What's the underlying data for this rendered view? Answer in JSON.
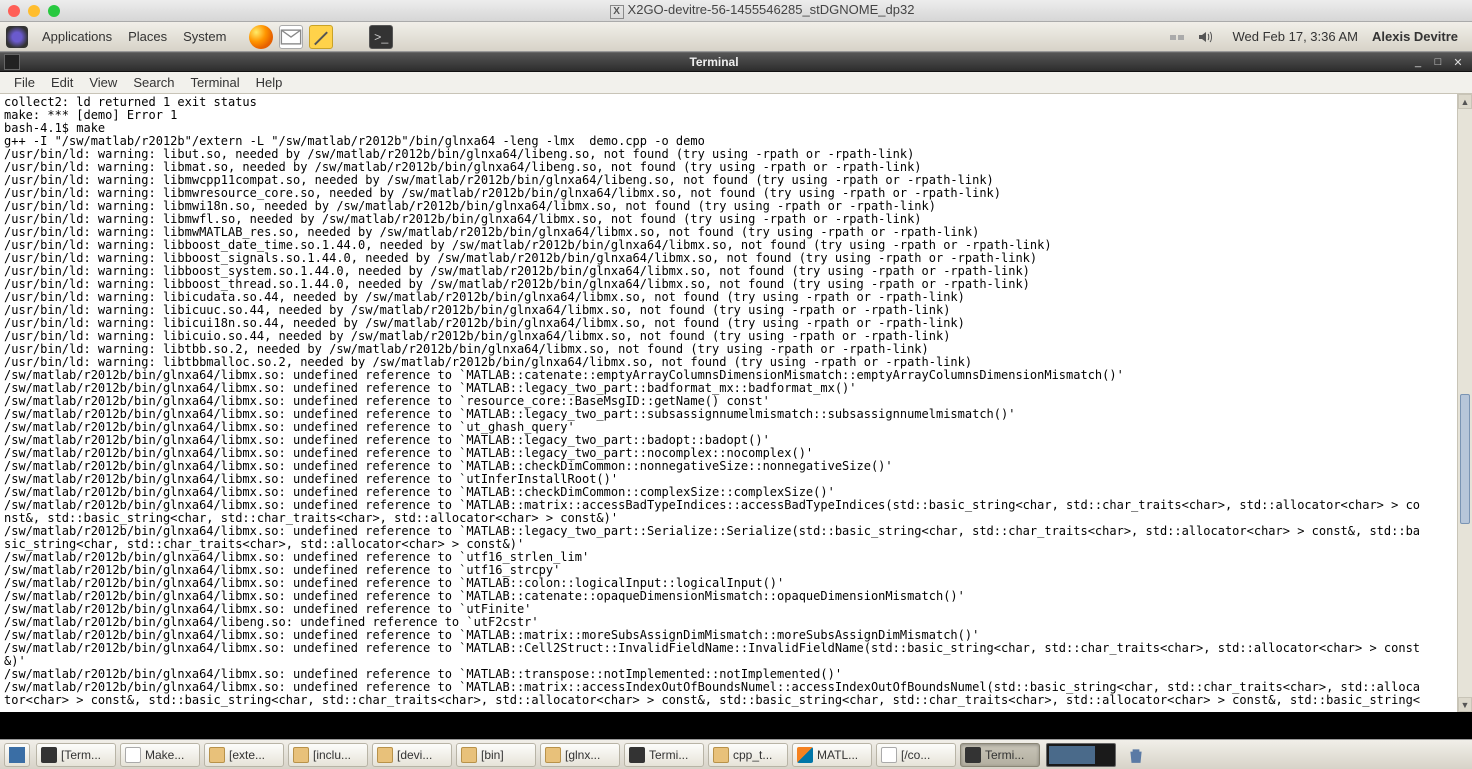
{
  "mac": {
    "title": "X2GO-devitre-56-1455546285_stDGNOME_dp32"
  },
  "gnome_top": {
    "applications": "Applications",
    "places": "Places",
    "system": "System",
    "clock": "Wed Feb 17,  3:36 AM",
    "user": "Alexis Devitre"
  },
  "terminal": {
    "title": "Terminal",
    "menus": {
      "file": "File",
      "edit": "Edit",
      "view": "View",
      "search": "Search",
      "terminal": "Terminal",
      "help": "Help"
    },
    "lines": [
      "collect2: ld returned 1 exit status",
      "make: *** [demo] Error 1",
      "bash-4.1$ make",
      "g++ -I \"/sw/matlab/r2012b\"/extern -L \"/sw/matlab/r2012b\"/bin/glnxa64 -leng -lmx  demo.cpp -o demo",
      "/usr/bin/ld: warning: libut.so, needed by /sw/matlab/r2012b/bin/glnxa64/libeng.so, not found (try using -rpath or -rpath-link)",
      "/usr/bin/ld: warning: libmat.so, needed by /sw/matlab/r2012b/bin/glnxa64/libeng.so, not found (try using -rpath or -rpath-link)",
      "/usr/bin/ld: warning: libmwcpp11compat.so, needed by /sw/matlab/r2012b/bin/glnxa64/libeng.so, not found (try using -rpath or -rpath-link)",
      "/usr/bin/ld: warning: libmwresource_core.so, needed by /sw/matlab/r2012b/bin/glnxa64/libmx.so, not found (try using -rpath or -rpath-link)",
      "/usr/bin/ld: warning: libmwi18n.so, needed by /sw/matlab/r2012b/bin/glnxa64/libmx.so, not found (try using -rpath or -rpath-link)",
      "/usr/bin/ld: warning: libmwfl.so, needed by /sw/matlab/r2012b/bin/glnxa64/libmx.so, not found (try using -rpath or -rpath-link)",
      "/usr/bin/ld: warning: libmwMATLAB_res.so, needed by /sw/matlab/r2012b/bin/glnxa64/libmx.so, not found (try using -rpath or -rpath-link)",
      "/usr/bin/ld: warning: libboost_date_time.so.1.44.0, needed by /sw/matlab/r2012b/bin/glnxa64/libmx.so, not found (try using -rpath or -rpath-link)",
      "/usr/bin/ld: warning: libboost_signals.so.1.44.0, needed by /sw/matlab/r2012b/bin/glnxa64/libmx.so, not found (try using -rpath or -rpath-link)",
      "/usr/bin/ld: warning: libboost_system.so.1.44.0, needed by /sw/matlab/r2012b/bin/glnxa64/libmx.so, not found (try using -rpath or -rpath-link)",
      "/usr/bin/ld: warning: libboost_thread.so.1.44.0, needed by /sw/matlab/r2012b/bin/glnxa64/libmx.so, not found (try using -rpath or -rpath-link)",
      "/usr/bin/ld: warning: libicudata.so.44, needed by /sw/matlab/r2012b/bin/glnxa64/libmx.so, not found (try using -rpath or -rpath-link)",
      "/usr/bin/ld: warning: libicuuc.so.44, needed by /sw/matlab/r2012b/bin/glnxa64/libmx.so, not found (try using -rpath or -rpath-link)",
      "/usr/bin/ld: warning: libicui18n.so.44, needed by /sw/matlab/r2012b/bin/glnxa64/libmx.so, not found (try using -rpath or -rpath-link)",
      "/usr/bin/ld: warning: libicuio.so.44, needed by /sw/matlab/r2012b/bin/glnxa64/libmx.so, not found (try using -rpath or -rpath-link)",
      "/usr/bin/ld: warning: libtbb.so.2, needed by /sw/matlab/r2012b/bin/glnxa64/libmx.so, not found (try using -rpath or -rpath-link)",
      "/usr/bin/ld: warning: libtbbmalloc.so.2, needed by /sw/matlab/r2012b/bin/glnxa64/libmx.so, not found (try using -rpath or -rpath-link)",
      "/sw/matlab/r2012b/bin/glnxa64/libmx.so: undefined reference to `MATLAB::catenate::emptyArrayColumnsDimensionMismatch::emptyArrayColumnsDimensionMismatch()'",
      "/sw/matlab/r2012b/bin/glnxa64/libmx.so: undefined reference to `MATLAB::legacy_two_part::badformat_mx::badformat_mx()'",
      "/sw/matlab/r2012b/bin/glnxa64/libmx.so: undefined reference to `resource_core::BaseMsgID::getName() const'",
      "/sw/matlab/r2012b/bin/glnxa64/libmx.so: undefined reference to `MATLAB::legacy_two_part::subsassignnumelmismatch::subsassignnumelmismatch()'",
      "/sw/matlab/r2012b/bin/glnxa64/libmx.so: undefined reference to `ut_ghash_query'",
      "/sw/matlab/r2012b/bin/glnxa64/libmx.so: undefined reference to `MATLAB::legacy_two_part::badopt::badopt()'",
      "/sw/matlab/r2012b/bin/glnxa64/libmx.so: undefined reference to `MATLAB::legacy_two_part::nocomplex::nocomplex()'",
      "/sw/matlab/r2012b/bin/glnxa64/libmx.so: undefined reference to `MATLAB::checkDimCommon::nonnegativeSize::nonnegativeSize()'",
      "/sw/matlab/r2012b/bin/glnxa64/libmx.so: undefined reference to `utInferInstallRoot()'",
      "/sw/matlab/r2012b/bin/glnxa64/libmx.so: undefined reference to `MATLAB::checkDimCommon::complexSize::complexSize()'",
      "/sw/matlab/r2012b/bin/glnxa64/libmx.so: undefined reference to `MATLAB::matrix::accessBadTypeIndices::accessBadTypeIndices(std::basic_string<char, std::char_traits<char>, std::allocator<char> > co",
      "nst&, std::basic_string<char, std::char_traits<char>, std::allocator<char> > const&)'",
      "/sw/matlab/r2012b/bin/glnxa64/libmx.so: undefined reference to `MATLAB::legacy_two_part::Serialize::Serialize(std::basic_string<char, std::char_traits<char>, std::allocator<char> > const&, std::ba",
      "sic_string<char, std::char_traits<char>, std::allocator<char> > const&)'",
      "/sw/matlab/r2012b/bin/glnxa64/libmx.so: undefined reference to `utf16_strlen_lim'",
      "/sw/matlab/r2012b/bin/glnxa64/libmx.so: undefined reference to `utf16_strcpy'",
      "/sw/matlab/r2012b/bin/glnxa64/libmx.so: undefined reference to `MATLAB::colon::logicalInput::logicalInput()'",
      "/sw/matlab/r2012b/bin/glnxa64/libmx.so: undefined reference to `MATLAB::catenate::opaqueDimensionMismatch::opaqueDimensionMismatch()'",
      "/sw/matlab/r2012b/bin/glnxa64/libmx.so: undefined reference to `utFinite'",
      "/sw/matlab/r2012b/bin/glnxa64/libeng.so: undefined reference to `utF2cstr'",
      "/sw/matlab/r2012b/bin/glnxa64/libmx.so: undefined reference to `MATLAB::matrix::moreSubsAssignDimMismatch::moreSubsAssignDimMismatch()'",
      "/sw/matlab/r2012b/bin/glnxa64/libmx.so: undefined reference to `MATLAB::Cell2Struct::InvalidFieldName::InvalidFieldName(std::basic_string<char, std::char_traits<char>, std::allocator<char> > const",
      "&)'",
      "/sw/matlab/r2012b/bin/glnxa64/libmx.so: undefined reference to `MATLAB::transpose::notImplemented::notImplemented()'",
      "/sw/matlab/r2012b/bin/glnxa64/libmx.so: undefined reference to `MATLAB::matrix::accessIndexOutOfBoundsNumel::accessIndexOutOfBoundsNumel(std::basic_string<char, std::char_traits<char>, std::alloca",
      "tor<char> > const&, std::basic_string<char, std::char_traits<char>, std::allocator<char> > const&, std::basic_string<char, std::char_traits<char>, std::allocator<char> > const&, std::basic_string<"
    ]
  },
  "taskbar": {
    "items": [
      {
        "icon": "term",
        "label": "[Term..."
      },
      {
        "icon": "gedit",
        "label": "Make..."
      },
      {
        "icon": "folder",
        "label": "[exte..."
      },
      {
        "icon": "folder",
        "label": "[inclu..."
      },
      {
        "icon": "folder",
        "label": "[devi..."
      },
      {
        "icon": "folder",
        "label": "[bin]"
      },
      {
        "icon": "folder",
        "label": "[glnx..."
      },
      {
        "icon": "term",
        "label": "Termi..."
      },
      {
        "icon": "folder",
        "label": "cpp_t..."
      },
      {
        "icon": "matlab",
        "label": "MATL..."
      },
      {
        "icon": "gedit",
        "label": "[/co..."
      },
      {
        "icon": "term",
        "label": "Termi...",
        "active": true
      }
    ]
  }
}
